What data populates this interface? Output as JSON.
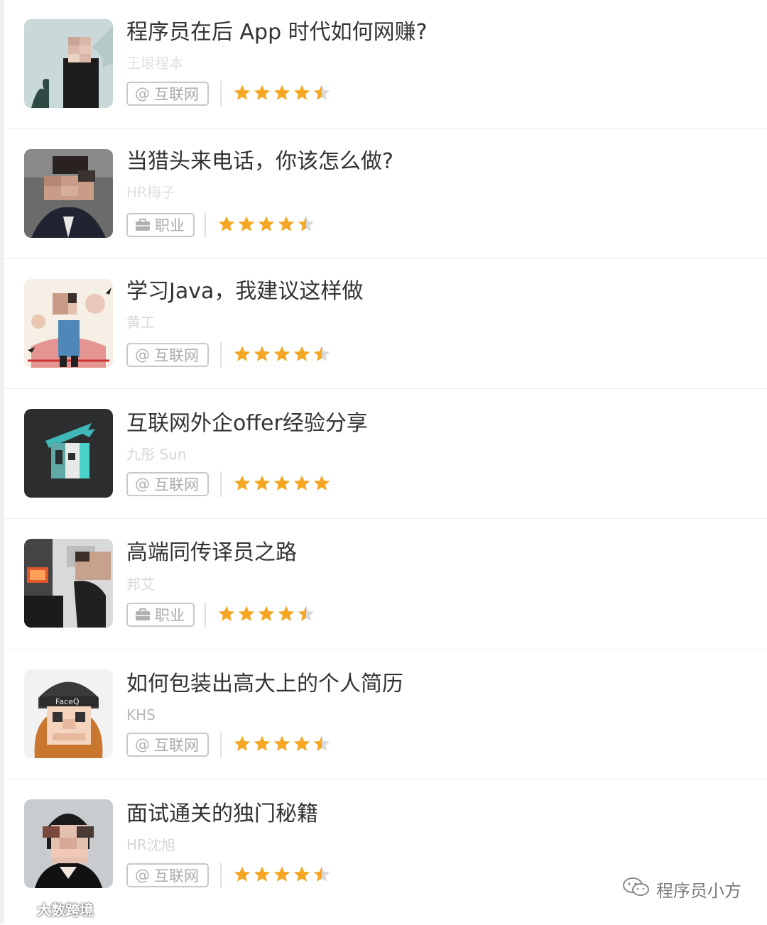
{
  "courses": [
    {
      "title": "程序员在后 App 时代如何网赚?",
      "author": "王垠程本",
      "tag": "互联网",
      "tag_icon": "at-icon",
      "rating": 4.5
    },
    {
      "title": "当猎头来电话，你该怎么做?",
      "author": "HR梅子",
      "tag": "职业",
      "tag_icon": "briefcase-icon",
      "rating": 4.5
    },
    {
      "title": "学习Java，我建议这样做",
      "author": "黄工",
      "tag": "互联网",
      "tag_icon": "at-icon",
      "rating": 4.5
    },
    {
      "title": "互联网外企offer经验分享",
      "author": "九彤 Sun",
      "tag": "互联网",
      "tag_icon": "at-icon",
      "rating": 5
    },
    {
      "title": "高端同传译员之路",
      "author": "邦艾",
      "tag": "职业",
      "tag_icon": "briefcase-icon",
      "rating": 4.5
    },
    {
      "title": "如何包装出高大上的个人简历",
      "author": "KHS",
      "tag": "互联网",
      "tag_icon": "at-icon",
      "rating": 4.5
    },
    {
      "title": "面试通关的独门秘籍",
      "author": "HR沈旭",
      "tag": "互联网",
      "tag_icon": "at-icon",
      "rating": 4.5
    }
  ],
  "watermark": {
    "left": "大数跨境",
    "right": "程序员小方"
  },
  "colors": {
    "star": "#F5A623",
    "star_empty": "#D8D8D8",
    "title": "#333333",
    "tag_border": "#C8C8C8"
  }
}
